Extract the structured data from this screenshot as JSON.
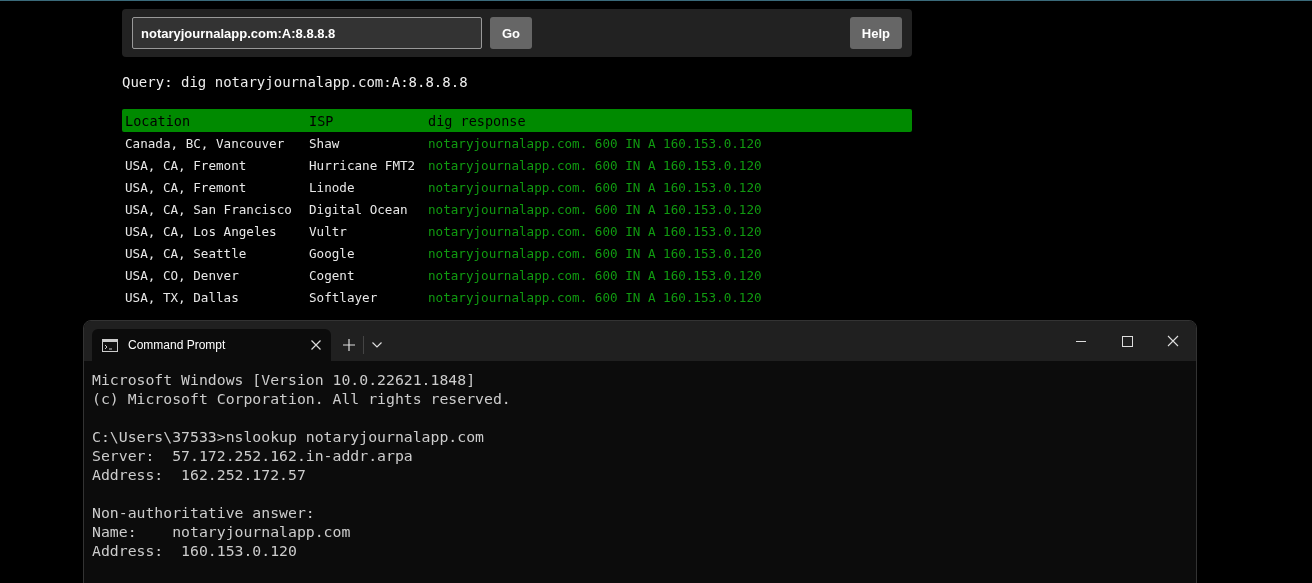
{
  "search": {
    "value": "notaryjournalapp.com:A:8.8.8.8"
  },
  "buttons": {
    "go": "Go",
    "help": "Help"
  },
  "query": "Query: dig notaryjournalapp.com:A:8.8.8.8",
  "table": {
    "columns": [
      "Location",
      "ISP",
      "dig response"
    ],
    "rows": [
      [
        "Canada, BC, Vancouver",
        "Shaw",
        "notaryjournalapp.com. 600 IN A 160.153.0.120"
      ],
      [
        "USA, CA, Fremont",
        "Hurricane FMT2",
        "notaryjournalapp.com. 600 IN A 160.153.0.120"
      ],
      [
        "USA, CA, Fremont",
        "Linode",
        "notaryjournalapp.com. 600 IN A 160.153.0.120"
      ],
      [
        "USA, CA, San Francisco",
        "Digital Ocean",
        "notaryjournalapp.com. 600 IN A 160.153.0.120"
      ],
      [
        "USA, CA, Los Angeles",
        "Vultr",
        "notaryjournalapp.com. 600 IN A 160.153.0.120"
      ],
      [
        "USA, CA, Seattle",
        "Google",
        "notaryjournalapp.com. 600 IN A 160.153.0.120"
      ],
      [
        "USA, CO, Denver",
        "Cogent",
        "notaryjournalapp.com. 600 IN A 160.153.0.120"
      ],
      [
        "USA, TX, Dallas",
        "Softlayer",
        "notaryjournalapp.com. 600 IN A 160.153.0.120"
      ]
    ]
  },
  "terminal": {
    "tabs": [
      {
        "title": "Command Prompt",
        "selected": true
      }
    ],
    "paragraphs": [
      [
        "Microsoft Windows [Version 10.0.22621.1848]",
        "(c) Microsoft Corporation. All rights reserved."
      ],
      [
        "C:\\Users\\37533>nslookup notaryjournalapp.com",
        "Server:  57.172.252.162.in-addr.arpa",
        "Address:  162.252.172.57"
      ],
      [
        "Non-authoritative answer:",
        "Name:    notaryjournalapp.com",
        "Address:  160.153.0.120"
      ]
    ]
  }
}
